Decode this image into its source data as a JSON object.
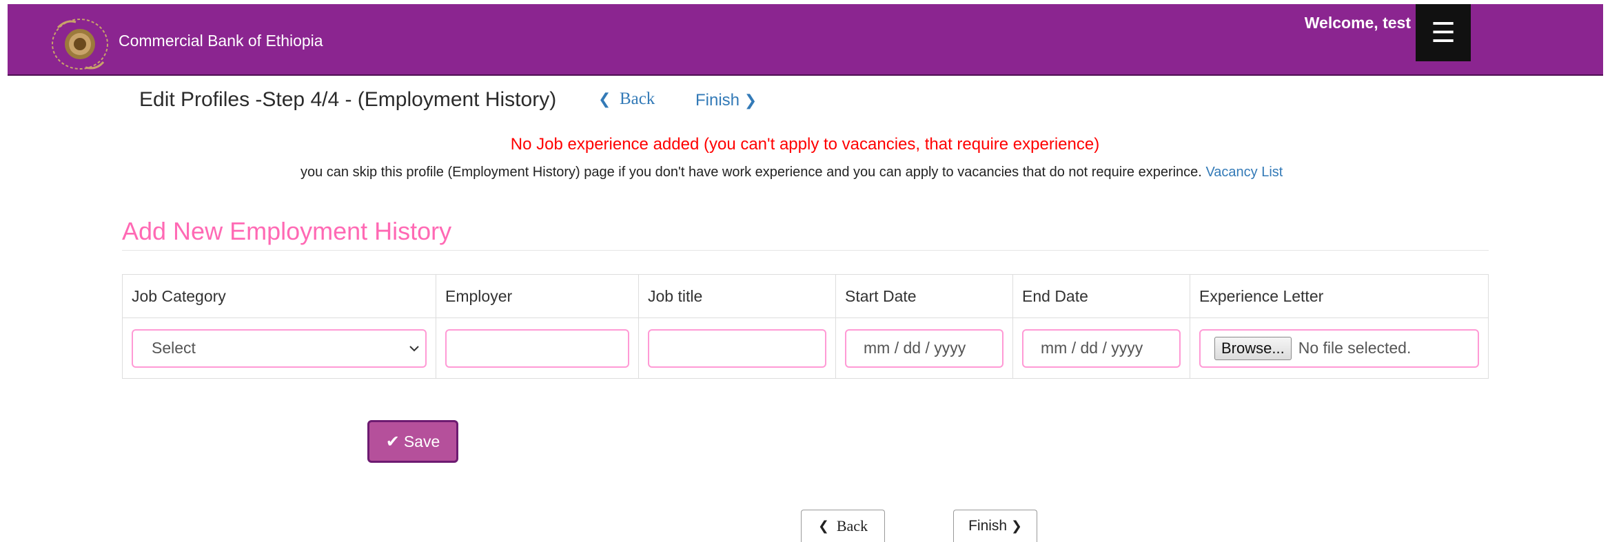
{
  "header": {
    "brand": "Commercial Bank of Ethiopia",
    "welcome": "Welcome, test",
    "menu_icon": "☰",
    "logo_icon": "bank-seal-icon",
    "background_color": "#8b2590"
  },
  "steps": {
    "title": "Edit Profiles -Step 4/4 - (Employment History)",
    "back_label": "Back",
    "finish_label": "Finish"
  },
  "notice": {
    "warning": "No Job experience added (you can't apply to vacancies, that require experience)",
    "info": "you can skip this profile (Employment History) page if you don't have work experience and you can apply to vacancies that do not require experince.",
    "vacancy_link": "Vacancy List",
    "warning_color": "#ff0000"
  },
  "form": {
    "title": "Add New Employment History",
    "title_color": "#ff69b4",
    "columns": [
      "Job Category",
      "Employer",
      "Job title",
      "Start Date",
      "End Date",
      "Experience Letter"
    ],
    "job_category_value": "Select",
    "employer_value": "",
    "job_title_value": "",
    "start_date_placeholder": "mm / dd / yyyy",
    "end_date_placeholder": "mm / dd / yyyy",
    "browse_label": "Browse...",
    "file_status": "No file selected.",
    "save_label": "Save"
  },
  "footer": {
    "back_label": "Back",
    "finish_label": "Finish"
  }
}
